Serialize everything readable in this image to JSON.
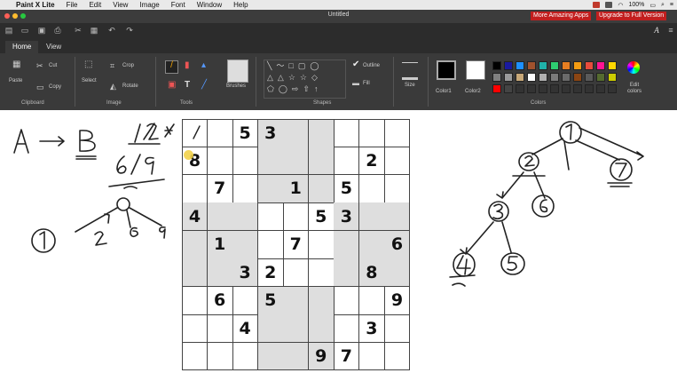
{
  "menubar": {
    "app": "Paint X Lite",
    "items": [
      "File",
      "Edit",
      "View",
      "Image",
      "Font",
      "Window",
      "Help"
    ],
    "battery": "100%"
  },
  "window": {
    "title": "Untitled",
    "promo_left": "More Amazing Apps",
    "promo_right": "Upgrade to Full Version"
  },
  "tabs": [
    "Home",
    "View"
  ],
  "ribbon": {
    "clipboard": {
      "paste": "Paste",
      "cut": "Cut",
      "copy": "Copy",
      "label": "Clipboard"
    },
    "image": {
      "select": "Select",
      "crop": "Crop",
      "rotate": "Rotate",
      "label": "Image"
    },
    "tools": {
      "label": "Tools"
    },
    "brushes": {
      "label": "Brushes"
    },
    "shapes": {
      "outline": "Outline",
      "fill": "Fill",
      "label": "Shapes"
    },
    "size": {
      "label": "Size"
    },
    "color1": "Color1",
    "color2": "Color2",
    "colors": {
      "label": "Colors",
      "edit": "Edit colors"
    },
    "palette": [
      "#000000",
      "#1a1aa0",
      "#1e90ff",
      "#a0522d",
      "#20b2aa",
      "#2ecc71",
      "#e67e22",
      "#f39c12",
      "#e74c3c",
      "#ff1493",
      "#ffd700",
      "#808080",
      "#9a9a9a",
      "#c8a878",
      "#ffffff",
      "#b0b0b0",
      "#7a7a7a",
      "#6a6a6a",
      "#8b4513",
      "#5a5a5a",
      "#556b2f",
      "#cccc00",
      "#ff0000",
      "#444444",
      "#333333",
      "#333333",
      "#333333",
      "#333333",
      "#333333",
      "#333333",
      "#333333",
      "#333333",
      "#333333"
    ]
  },
  "sudoku": {
    "rows": [
      [
        "1",
        "",
        "5",
        "3",
        "",
        "",
        "",
        "",
        ""
      ],
      [
        "8",
        "",
        "",
        "",
        "",
        "",
        "",
        "2",
        ""
      ],
      [
        "",
        "7",
        "",
        "",
        "1",
        "",
        "5",
        "",
        ""
      ],
      [
        "4",
        "",
        "",
        "",
        "",
        "5",
        "3",
        "",
        ""
      ],
      [
        "",
        "1",
        "",
        "",
        "7",
        "",
        "",
        "",
        "6"
      ],
      [
        "",
        "",
        "3",
        "2",
        "",
        "",
        "",
        "8",
        ""
      ],
      [
        "",
        "6",
        "",
        "5",
        "",
        "",
        "",
        "",
        "9"
      ],
      [
        "",
        "",
        "4",
        "",
        "",
        "",
        "",
        "3",
        ""
      ],
      [
        "",
        "",
        "",
        "",
        "",
        "9",
        "7",
        "",
        ""
      ]
    ],
    "handwritten": [
      "1"
    ]
  },
  "annotations": {
    "a_to_b": [
      "A",
      "B"
    ],
    "fractions": [
      "1/2",
      "6/9"
    ],
    "left_tree": [
      "1",
      "2",
      "6",
      "9"
    ],
    "right_tree": [
      "1",
      "2",
      "7",
      "3",
      "6",
      "4",
      "5"
    ]
  }
}
